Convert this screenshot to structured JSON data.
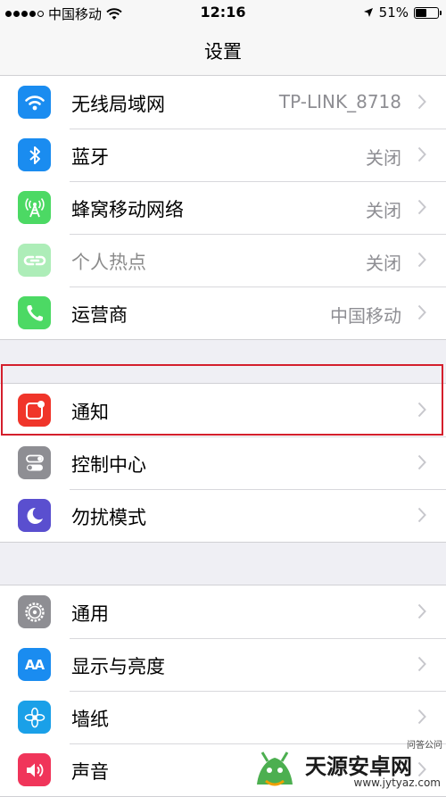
{
  "status_bar": {
    "carrier": "中国移动",
    "time": "12:16",
    "battery": "51%"
  },
  "nav": {
    "title": "设置"
  },
  "groups": [
    {
      "rows": [
        {
          "label": "无线局域网",
          "value": "TP-LINK_8718",
          "icon": "wifi-icon",
          "color": "#1a8cf0"
        },
        {
          "label": "蓝牙",
          "value": "关闭",
          "icon": "bluetooth-icon",
          "color": "#1a8cf0"
        },
        {
          "label": "蜂窝移动网络",
          "value": "关闭",
          "icon": "cellular-icon",
          "color": "#4cd964"
        },
        {
          "label": "个人热点",
          "value": "关闭",
          "icon": "hotspot-icon",
          "color": "#4cd964"
        },
        {
          "label": "运营商",
          "value": "中国移动",
          "icon": "phone-icon",
          "color": "#4cd964"
        }
      ]
    },
    {
      "rows": [
        {
          "label": "通知",
          "icon": "notifications-icon",
          "color": "#f0352a"
        },
        {
          "label": "控制中心",
          "icon": "control-center-icon",
          "color": "#8e8e93"
        },
        {
          "label": "勿扰模式",
          "icon": "moon-icon",
          "color": "#5a4fcf"
        }
      ]
    },
    {
      "rows": [
        {
          "label": "通用",
          "icon": "gear-icon",
          "color": "#8e8e93"
        },
        {
          "label": "显示与亮度",
          "icon": "display-icon",
          "color": "#1a8cf0"
        },
        {
          "label": "墙纸",
          "icon": "wallpaper-icon",
          "color": "#1aa0e8"
        },
        {
          "label": "声音",
          "icon": "sound-icon",
          "color": "#f0355a"
        }
      ]
    }
  ],
  "display_icon_text": "AA",
  "watermark": {
    "name": "天源安卓网",
    "url": "www.jytyaz.com",
    "corner": "问答公问"
  }
}
